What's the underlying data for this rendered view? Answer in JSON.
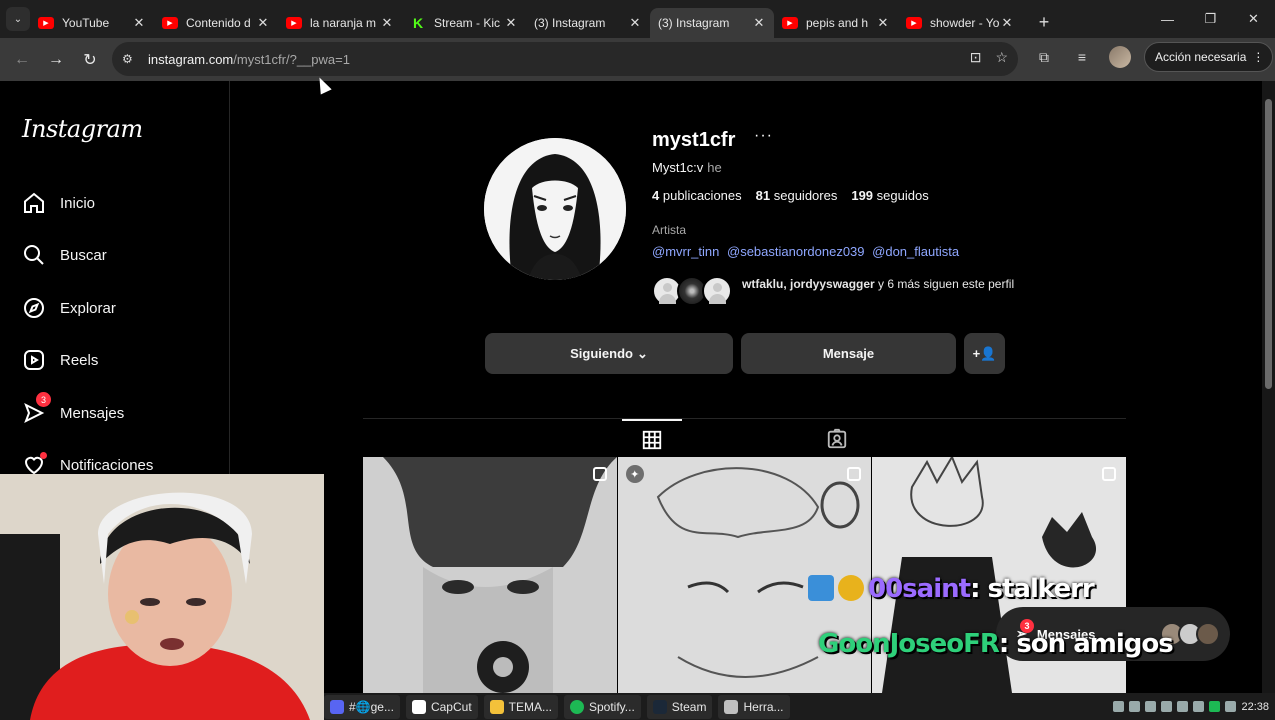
{
  "browser": {
    "tabs": [
      {
        "title": "YouTube",
        "icon": "youtube-icon",
        "active": false
      },
      {
        "title": "Contenido d",
        "icon": "youtube-icon",
        "active": false
      },
      {
        "title": "la naranja m",
        "icon": "youtube-icon",
        "active": false
      },
      {
        "title": "Stream - Kic",
        "icon": "kick-icon",
        "active": false
      },
      {
        "title": "(3) Instagram",
        "icon": "instagram-icon",
        "active": false
      },
      {
        "title": "(3) Instagram",
        "icon": "instagram-icon",
        "active": true
      },
      {
        "title": "pepis and h",
        "icon": "youtube-icon",
        "active": false
      },
      {
        "title": "showder - Yo",
        "icon": "youtube-icon",
        "active": false
      }
    ],
    "url_host": "instagram.com",
    "url_path": "/myst1cfr/?__pwa=1",
    "action_button": "Acción necesaria"
  },
  "instagram": {
    "logo": "Instagram",
    "nav": [
      {
        "label": "Inicio",
        "icon": "home-icon"
      },
      {
        "label": "Buscar",
        "icon": "search-icon"
      },
      {
        "label": "Explorar",
        "icon": "explore-icon"
      },
      {
        "label": "Reels",
        "icon": "reels-icon"
      },
      {
        "label": "Mensajes",
        "icon": "messenger-icon",
        "badge": "3"
      },
      {
        "label": "Notificaciones",
        "icon": "heart-icon"
      }
    ],
    "profile": {
      "username": "myst1cfr",
      "more": "···",
      "full_name": "Myst1c:v",
      "pronouns": "he",
      "stats": {
        "posts": "4",
        "posts_label": "publicaciones",
        "followers": "81",
        "followers_label": "seguidores",
        "following": "199",
        "following_label": "seguidos"
      },
      "category": "Artista",
      "mentions": [
        "@mvrr_tinn",
        "@sebastianordonez039",
        "@don_flautista"
      ],
      "followed_by_names": "wtfaklu, jordyyswagger",
      "followed_by_rest": " y 6 más siguen este perfil",
      "btn_following": "Siguiendo",
      "btn_message": "Mensaje"
    },
    "messages_pill": {
      "label": "Mensajes",
      "badge": "3"
    }
  },
  "stream_chat": [
    {
      "user": "00saint",
      "text": ": stalkerr"
    },
    {
      "user": "GoonJoseoFR",
      "text": ": son amigos"
    }
  ],
  "taskbar": {
    "tasks": [
      "#🌐ge...",
      "CapCut",
      "TEMA...",
      "Spotify...",
      "Steam",
      "Herra..."
    ],
    "clock": "22:38"
  },
  "colors": {
    "accent_link": "#8fa7ff",
    "badge_red": "#ff3040",
    "button_bg": "#363636"
  }
}
